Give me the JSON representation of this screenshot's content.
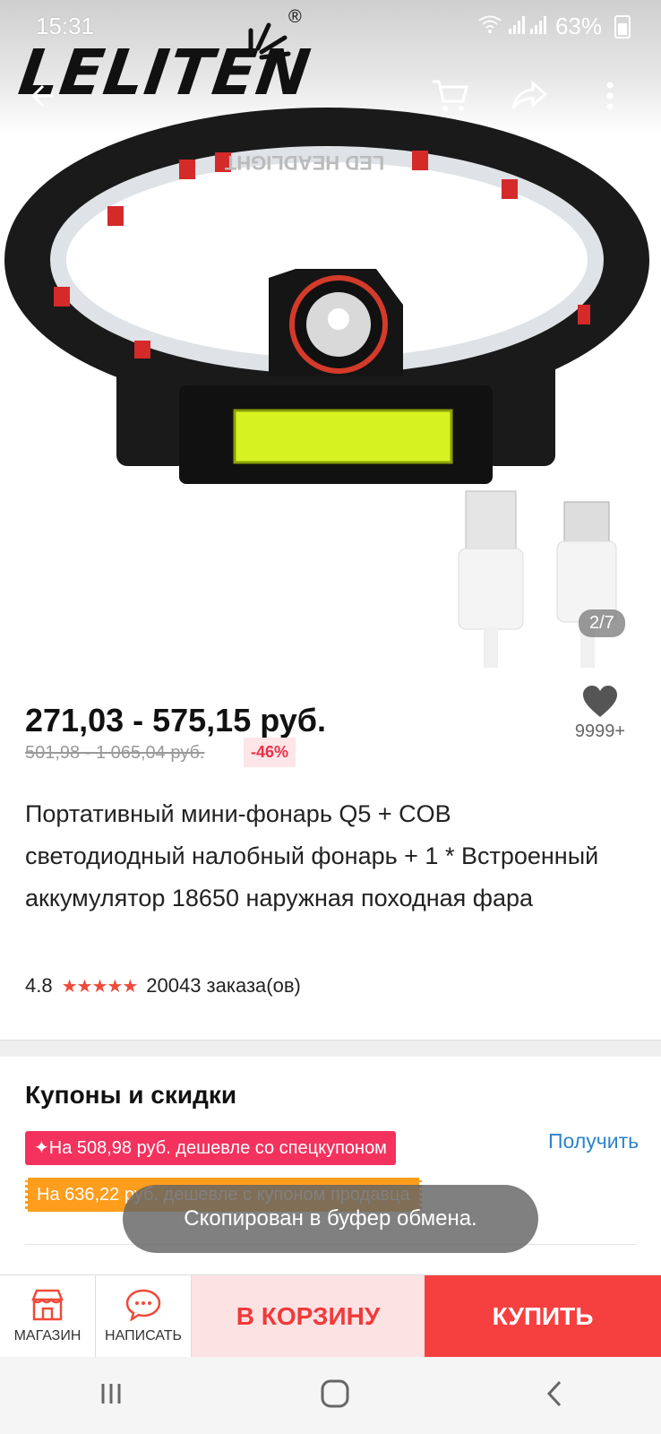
{
  "status_bar": {
    "time": "15:31",
    "battery": "63%"
  },
  "brand": {
    "logo_text": "LELITEN",
    "registered": "®"
  },
  "gallery": {
    "counter": "2/7",
    "band_text": "LED HEADLIGHT"
  },
  "product": {
    "price": "271,03 - 575,15 руб.",
    "old_price": "501,98 - 1 065,04 руб.",
    "discount": "-46%",
    "favorites_count": "9999+",
    "title": "Портативный мини-фонарь Q5 + COB светодиодный налобный фонарь + 1 * Встроенный аккумулятор 18650 наружная походная фара",
    "rating": "4.8",
    "stars": "★★★★★",
    "orders": "20043 заказа(ов)"
  },
  "coupons": {
    "title": "Купоны и скидки",
    "special_coupon": "✦На 508,98 руб. дешевле со спецкупоном",
    "seller_coupon": "На 636,22 руб. дешевле с купоном продавца",
    "get_label": "Получить"
  },
  "toast": "Скопирован в буфер обмена.",
  "bottom_bar": {
    "store_label": "МАГАЗИН",
    "message_label": "НАПИСАТЬ",
    "cart_label": "В КОРЗИНУ",
    "buy_label": "КУПИТЬ"
  },
  "colors": {
    "accent": "#f64040",
    "link": "#2d84c9",
    "coupon_pink": "#f3325e",
    "coupon_orange": "#ff9d1d"
  }
}
